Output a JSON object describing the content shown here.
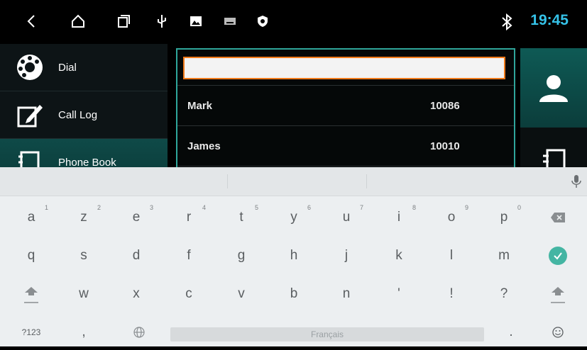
{
  "status_bar": {
    "icons": [
      "back-icon",
      "home-icon",
      "recents-icon",
      "usb-icon",
      "image-icon",
      "keyboard-indicator-icon",
      "shield-icon",
      "bluetooth-icon"
    ],
    "time": "19:45"
  },
  "sidebar": {
    "items": [
      {
        "label": "Dial",
        "icon": "rotary-phone-icon"
      },
      {
        "label": "Call Log",
        "icon": "edit-note-icon"
      },
      {
        "label": "Phone Book",
        "icon": "phonebook-icon"
      }
    ]
  },
  "search": {
    "value": ""
  },
  "contacts": [
    {
      "name": "Mark",
      "number": "10086"
    },
    {
      "name": "James",
      "number": "10010"
    }
  ],
  "keyboard": {
    "row1": [
      {
        "label": "a",
        "hint": "1"
      },
      {
        "label": "z",
        "hint": "2"
      },
      {
        "label": "e",
        "hint": "3"
      },
      {
        "label": "r",
        "hint": "4"
      },
      {
        "label": "t",
        "hint": "5"
      },
      {
        "label": "y",
        "hint": "6"
      },
      {
        "label": "u",
        "hint": "7"
      },
      {
        "label": "i",
        "hint": "8"
      },
      {
        "label": "o",
        "hint": "9"
      },
      {
        "label": "p",
        "hint": "0"
      }
    ],
    "row2": [
      "q",
      "s",
      "d",
      "f",
      "g",
      "h",
      "j",
      "k",
      "l",
      "m"
    ],
    "row3": [
      "w",
      "x",
      "c",
      "v",
      "b",
      "n",
      "'",
      "!",
      "?"
    ],
    "symbols_label": "?123",
    "comma_label": ",",
    "space_label": "Français",
    "period_label": ".",
    "accent_color": "#44b5a3"
  }
}
